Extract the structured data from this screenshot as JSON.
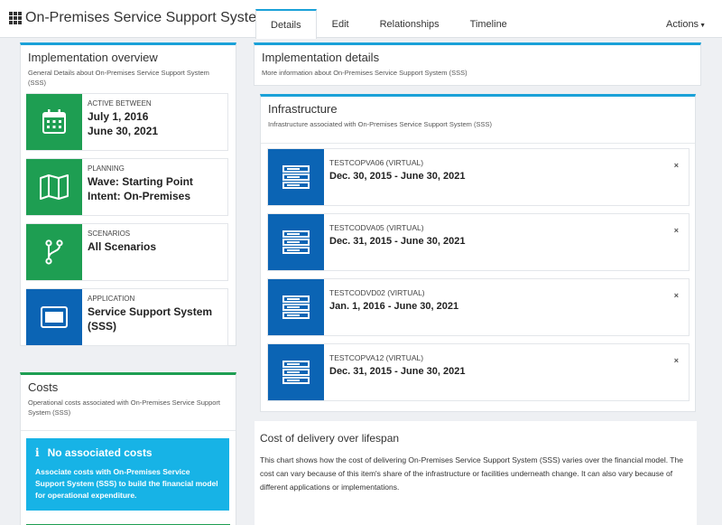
{
  "header": {
    "title": "On-Premises Service Support System (SSS)",
    "tabs": [
      {
        "label": "Details"
      },
      {
        "label": "Edit"
      },
      {
        "label": "Relationships"
      },
      {
        "label": "Timeline"
      }
    ],
    "actions_label": "Actions"
  },
  "overview": {
    "title": "Implementation overview",
    "subtitle": "General Details about On-Premises Service Support System (SSS)",
    "cards": [
      {
        "label": "ACTIVE BETWEEN",
        "line1": "July 1, 2016",
        "line2": "June 30, 2021",
        "icon": "calendar-icon"
      },
      {
        "label": "PLANNING",
        "line1": "Wave: Starting Point",
        "line2": "Intent: On-Premises",
        "icon": "map-icon"
      },
      {
        "label": "SCENARIOS",
        "line1": "All Scenarios",
        "line2": "",
        "icon": "branch-icon"
      },
      {
        "label": "APPLICATION",
        "line1": "Service Support System",
        "line2": "(SSS)",
        "icon": "window-icon"
      }
    ]
  },
  "costs": {
    "title": "Costs",
    "subtitle": "Operational costs associated with On-Premises Service Support System (SSS)",
    "alert_title": "No associated costs",
    "alert_body": "Associate costs with On-Premises Service Support System (SSS) to build the financial model for operational expenditure."
  },
  "details": {
    "title": "Implementation details",
    "subtitle": "More information about On-Premises Service Support System (SSS)"
  },
  "infrastructure": {
    "title": "Infrastructure",
    "subtitle": "Infrastructure associated with On-Premises Service Support System (SSS)",
    "items": [
      {
        "name": "TESTCOPVA06 (VIRTUAL)",
        "dates": "Dec. 30, 2015 - June 30, 2021"
      },
      {
        "name": "TESTCODVA05 (VIRTUAL)",
        "dates": "Dec. 31, 2015 - June 30, 2021"
      },
      {
        "name": "TESTCODVD02 (VIRTUAL)",
        "dates": "Jan. 1, 2016 - June 30, 2021"
      },
      {
        "name": "TESTCOPVA12 (VIRTUAL)",
        "dates": "Dec. 31, 2015 - June 30, 2021"
      }
    ],
    "remove_glyph": "×"
  },
  "cost_delivery": {
    "title": "Cost of delivery over lifespan",
    "body": "This chart shows how the cost of delivering On-Premises Service Support System (SSS) varies over the financial model. The cost can vary because of this item's share of the infrastructure or facilities underneath change. It can also vary because of different applications or implementations."
  },
  "colors": {
    "accent_blue": "#1aa1d8",
    "green": "#1e9e52",
    "dark_blue": "#0b64b4",
    "alert": "#17b3e6"
  }
}
